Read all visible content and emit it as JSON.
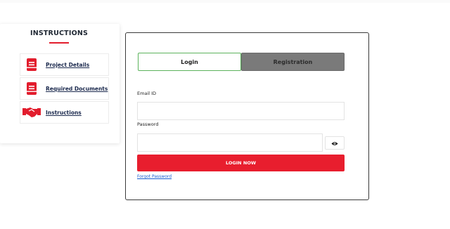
{
  "sidebar": {
    "title": "INSTRUCTIONS",
    "items": [
      {
        "label": "Project Details",
        "icon": "document-icon"
      },
      {
        "label": "Required Documents",
        "icon": "document-icon"
      },
      {
        "label": "Instructions",
        "icon": "handshake-icon"
      }
    ]
  },
  "auth": {
    "tabs": {
      "login": "Login",
      "registration": "Registration"
    },
    "email": {
      "label": "Email ID",
      "value": "",
      "placeholder": ""
    },
    "password": {
      "label": "Password",
      "value": "",
      "placeholder": ""
    },
    "show_password_icon": "eye-icon",
    "submit_label": "LOGIN NOW",
    "forgot_label": "Forgot Password"
  },
  "colors": {
    "accent": "#e81e2e",
    "active_tab_border": "#5cb35c",
    "inactive_tab": "#7a7a7a",
    "link": "#1a5fd0"
  }
}
